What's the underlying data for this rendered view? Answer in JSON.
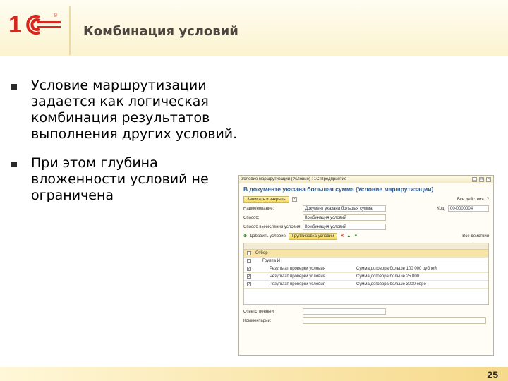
{
  "header": {
    "title": "Комбинация условий"
  },
  "bullets": [
    "Условие маршрутизации задается как логическая комбинация результатов выполнения других условий.",
    "При этом глубина вложенности условий не ограничена"
  ],
  "footer": {
    "page_number": "25"
  },
  "window": {
    "title": "Условие маршрутизации (Условие) : 1С:Предприятие",
    "heading": "В документе указана большая сумма (Условие маршрутизации)",
    "save_button": "Записать и закрыть",
    "all_actions": "Все действия",
    "fields": {
      "name_label": "Наименование:",
      "name_value": "Документ указана большая сумма",
      "code_label": "Код:",
      "code_value": "00-0000004",
      "type_label": "Способ:",
      "type_value": "Комбинация условий",
      "expression_label": "Способ вычисления условия:",
      "expression_value": "Комбинация условий"
    },
    "toolbar": {
      "add_condition": "Добавить условие",
      "group": "Группировка условий",
      "all_actions": "Все действия"
    },
    "grid_rows": [
      {
        "indent": 0,
        "check": false,
        "label": "Отбор",
        "value": ""
      },
      {
        "indent": 1,
        "check": false,
        "label": "Группа И",
        "value": ""
      },
      {
        "indent": 2,
        "check": true,
        "label": "Результат проверки условия",
        "value": "Сумма договора больше 100 000 рублей"
      },
      {
        "indent": 2,
        "check": true,
        "label": "Результат проверки условия",
        "value": "Сумма договора больше 25 000"
      },
      {
        "indent": 2,
        "check": true,
        "label": "Результат проверки условия",
        "value": "Сумма договора больше 3000 евро"
      }
    ],
    "bottom_fields": {
      "responsible_label": "Ответственный:",
      "comment_label": "Комментарий:"
    }
  },
  "colors": {
    "accent": "#2b5d9a",
    "logo_red": "#d6281e"
  }
}
